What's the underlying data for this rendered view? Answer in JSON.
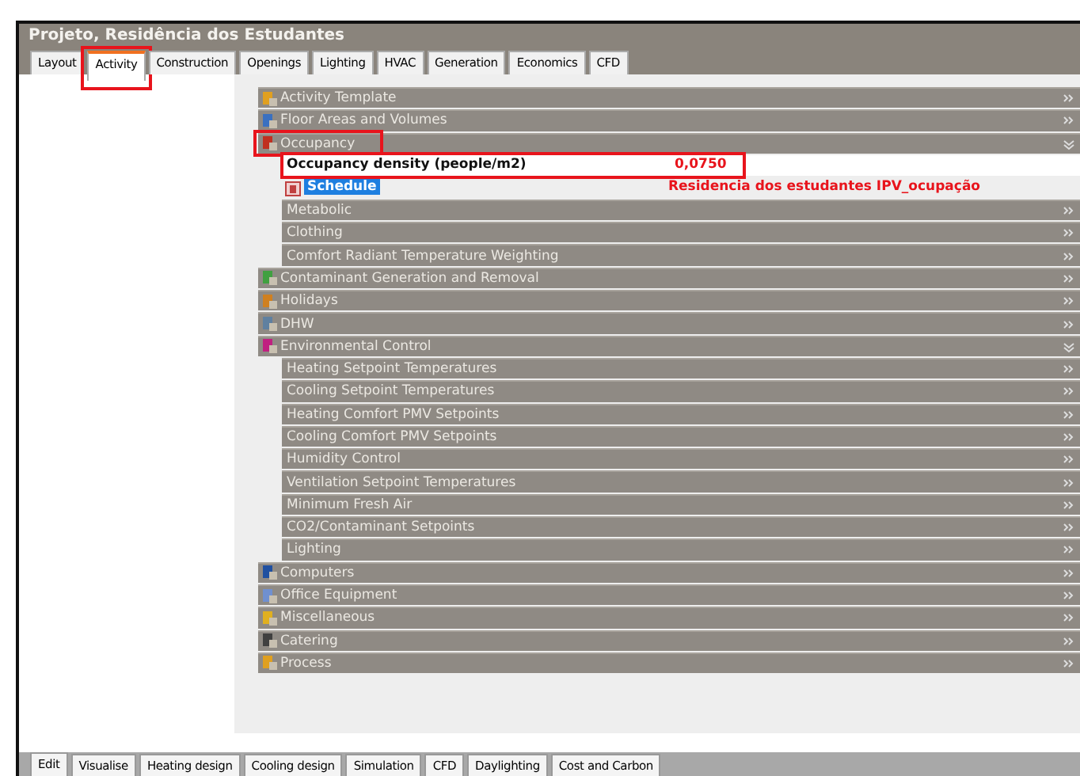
{
  "window": {
    "title": "Projeto, Residência dos Estudantes"
  },
  "tabs": [
    {
      "label": "Layout",
      "selected": false,
      "highlighted": false
    },
    {
      "label": "Activity",
      "selected": true,
      "highlighted": true
    },
    {
      "label": "Construction",
      "selected": false,
      "highlighted": false
    },
    {
      "label": "Openings",
      "selected": false,
      "highlighted": false
    },
    {
      "label": "Lighting",
      "selected": false,
      "highlighted": false
    },
    {
      "label": "HVAC",
      "selected": false,
      "highlighted": false
    },
    {
      "label": "Generation",
      "selected": false,
      "highlighted": false
    },
    {
      "label": "Economics",
      "selected": false,
      "highlighted": false
    },
    {
      "label": "CFD",
      "selected": false,
      "highlighted": false
    }
  ],
  "sections": [
    {
      "label": "Activity Template",
      "expanded": false,
      "highlighted": false
    },
    {
      "label": "Floor Areas and Volumes",
      "expanded": false,
      "highlighted": false
    },
    {
      "label": "Occupancy",
      "expanded": true,
      "highlighted": true,
      "children": [
        {
          "kind": "field",
          "label": "Occupancy density (people/m2)",
          "value": "0,0750",
          "highlighted": true
        },
        {
          "kind": "schedule",
          "label": "Schedule",
          "value": "Residencia dos estudantes IPV_ocupação"
        },
        {
          "kind": "group",
          "label": "Metabolic",
          "expanded": false
        },
        {
          "kind": "group",
          "label": "Clothing",
          "expanded": false
        },
        {
          "kind": "group",
          "label": "Comfort Radiant Temperature Weighting",
          "expanded": false
        }
      ]
    },
    {
      "label": "Contaminant Generation and Removal",
      "expanded": false,
      "highlighted": false
    },
    {
      "label": "Holidays",
      "expanded": false,
      "highlighted": false
    },
    {
      "label": "DHW",
      "expanded": false,
      "highlighted": false
    },
    {
      "label": "Environmental Control",
      "expanded": true,
      "highlighted": false,
      "children": [
        {
          "kind": "group",
          "label": "Heating Setpoint Temperatures",
          "expanded": false
        },
        {
          "kind": "group",
          "label": "Cooling Setpoint Temperatures",
          "expanded": false
        },
        {
          "kind": "group",
          "label": "Heating Comfort PMV Setpoints",
          "expanded": false
        },
        {
          "kind": "group",
          "label": "Cooling Comfort PMV Setpoints",
          "expanded": false
        },
        {
          "kind": "group",
          "label": "Humidity Control",
          "expanded": false
        },
        {
          "kind": "group",
          "label": "Ventilation Setpoint Temperatures",
          "expanded": false
        },
        {
          "kind": "group",
          "label": "Minimum Fresh Air",
          "expanded": false
        },
        {
          "kind": "group",
          "label": "CO2/Contaminant Setpoints",
          "expanded": false
        },
        {
          "kind": "group",
          "label": "Lighting",
          "expanded": false
        }
      ]
    },
    {
      "label": "Computers",
      "expanded": false,
      "highlighted": false
    },
    {
      "label": "Office Equipment",
      "expanded": false,
      "highlighted": false
    },
    {
      "label": "Miscellaneous",
      "expanded": false,
      "highlighted": false
    },
    {
      "label": "Catering",
      "expanded": false,
      "highlighted": false
    },
    {
      "label": "Process",
      "expanded": false,
      "highlighted": false
    }
  ],
  "bottom_tabs": [
    {
      "label": "Edit",
      "selected": true
    },
    {
      "label": "Visualise",
      "selected": false
    },
    {
      "label": "Heating design",
      "selected": false
    },
    {
      "label": "Cooling design",
      "selected": false
    },
    {
      "label": "Simulation",
      "selected": false
    },
    {
      "label": "CFD",
      "selected": false
    },
    {
      "label": "Daylighting",
      "selected": false
    },
    {
      "label": "Cost and Carbon",
      "selected": false
    }
  ]
}
